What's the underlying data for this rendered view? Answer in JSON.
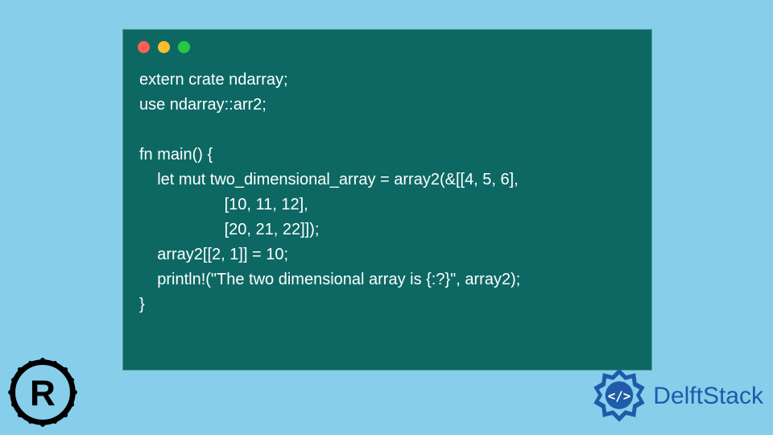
{
  "code": {
    "line1": "extern crate ndarray;",
    "line2": "use ndarray::arr2;",
    "line3": "",
    "line4": "fn main() {",
    "line5": "    let mut two_dimensional_array = array2(&[[4, 5, 6],",
    "line6": "                   [10, 11, 12],",
    "line7": "                   [20, 21, 22]]);",
    "line8": "    array2[[2, 1]] = 10;",
    "line9": "    println!(\"The two dimensional array is {:?}\", array2);",
    "line10": "}"
  },
  "branding": {
    "delft_text": "DelftStack"
  }
}
